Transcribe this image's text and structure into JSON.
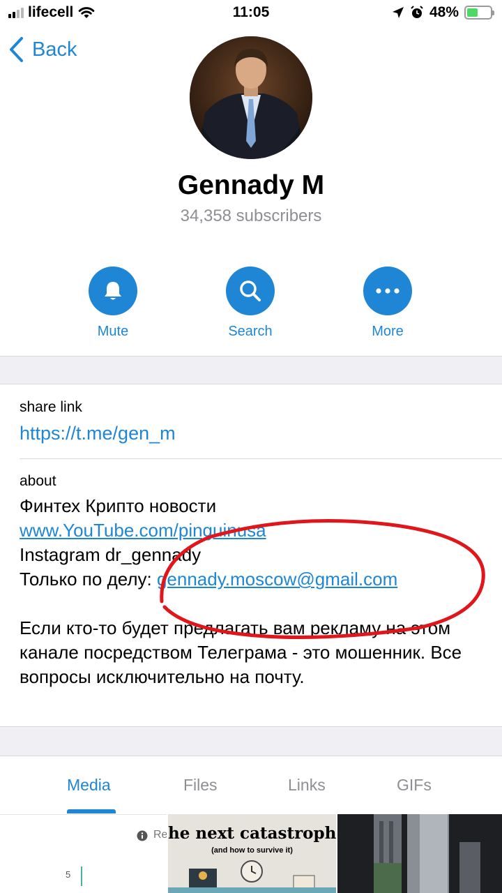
{
  "status_bar": {
    "carrier": "lifecell",
    "time": "11:05",
    "battery_percent": "48%",
    "battery_level": 0.48
  },
  "nav": {
    "back_label": "Back"
  },
  "channel": {
    "name": "Gennady M",
    "subscribers": "34,358 subscribers"
  },
  "actions": [
    {
      "label": "Mute",
      "icon": "bell-icon"
    },
    {
      "label": "Search",
      "icon": "search-icon"
    },
    {
      "label": "More",
      "icon": "more-dots-icon"
    }
  ],
  "share": {
    "title": "share link",
    "url": "https://t.me/gen_m"
  },
  "about": {
    "title": "about",
    "line1": "Финтех Крипто новости",
    "youtube": "www.YouTube.com/pinguinusa",
    "instagram": "Instagram dr_gennady",
    "email_prefix": "Только по делу: ",
    "email": "gennady.moscow@gmail.com",
    "paragraph": "Если кто-то будет предлагать вам рекламу на этом канале посредством  Телеграма - это мошенник. Все вопросы исключительно на почту."
  },
  "tabs": [
    {
      "label": "Media",
      "active": true
    },
    {
      "label": "Files",
      "active": false
    },
    {
      "label": "Links",
      "active": false
    },
    {
      "label": "GIFs",
      "active": false
    }
  ],
  "media": {
    "thumb1_text": "Re",
    "thumb1_number": "5",
    "thumb2_title": "he next catastroph",
    "thumb2_subtitle": "(and how to survive it)"
  },
  "colors": {
    "accent": "#1f86d5",
    "annotation": "#e0161b",
    "separator": "#efeff4"
  }
}
